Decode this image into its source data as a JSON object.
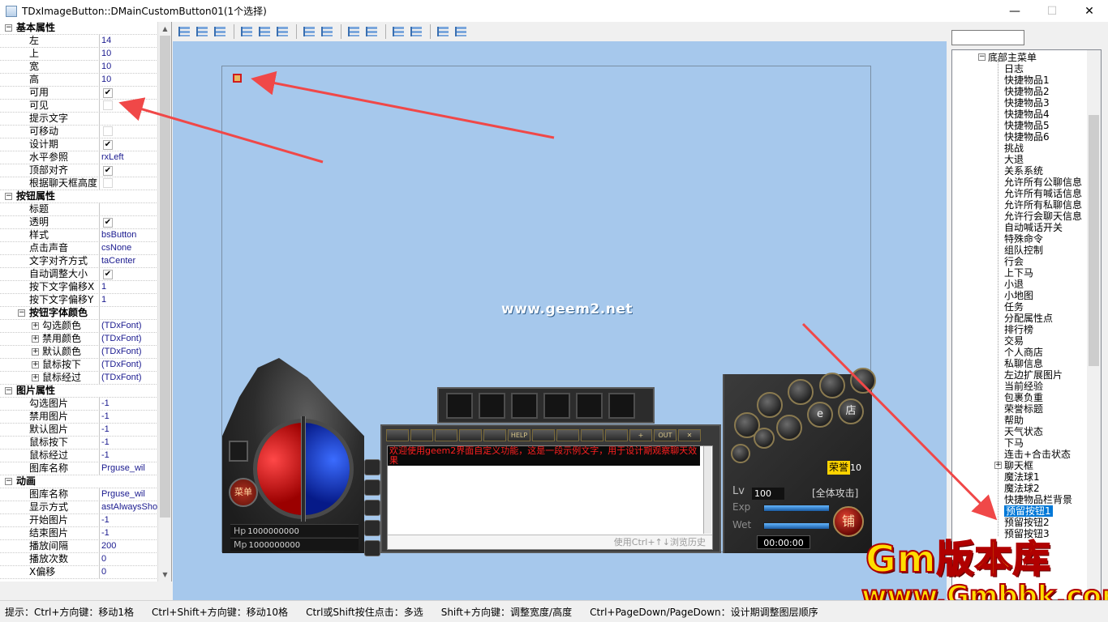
{
  "window": {
    "title": "TDxImageButton::DMainCustomButton01(1个选择)",
    "minimize": "—",
    "maximize": "☐",
    "close": "✕"
  },
  "props": {
    "cat_basic": "基本属性",
    "rows_basic": [
      {
        "k": "左",
        "v": "14"
      },
      {
        "k": "上",
        "v": "10"
      },
      {
        "k": "宽",
        "v": "10"
      },
      {
        "k": "高",
        "v": "10"
      },
      {
        "k": "可用",
        "v": "✔"
      },
      {
        "k": "可见",
        "v": ""
      },
      {
        "k": "提示文字",
        "v": ""
      },
      {
        "k": "可移动",
        "v": ""
      },
      {
        "k": "设计期",
        "v": "✔"
      },
      {
        "k": "水平参照",
        "v": "rxLeft"
      },
      {
        "k": "顶部对齐",
        "v": "✔"
      },
      {
        "k": "根据聊天框高度",
        "v": ""
      }
    ],
    "cat_button": "按钮属性",
    "rows_button": [
      {
        "k": "标题",
        "v": ""
      },
      {
        "k": "透明",
        "v": "✔"
      },
      {
        "k": "样式",
        "v": "bsButton"
      },
      {
        "k": "点击声音",
        "v": "csNone"
      },
      {
        "k": "文字对齐方式",
        "v": "taCenter"
      },
      {
        "k": "自动调整大小",
        "v": "✔"
      },
      {
        "k": "按下文字偏移X",
        "v": "1"
      },
      {
        "k": "按下文字偏移Y",
        "v": "1"
      }
    ],
    "subcat_fontcolor": "按钮字体颜色",
    "rows_font": [
      {
        "k": "勾选颜色",
        "v": "(TDxFont)"
      },
      {
        "k": "禁用颜色",
        "v": "(TDxFont)"
      },
      {
        "k": "默认颜色",
        "v": "(TDxFont)"
      },
      {
        "k": "鼠标按下",
        "v": "(TDxFont)"
      },
      {
        "k": "鼠标经过",
        "v": "(TDxFont)"
      }
    ],
    "cat_image": "图片属性",
    "rows_image": [
      {
        "k": "勾选图片",
        "v": "-1"
      },
      {
        "k": "禁用图片",
        "v": "-1"
      },
      {
        "k": "默认图片",
        "v": "-1"
      },
      {
        "k": "鼠标按下",
        "v": "-1"
      },
      {
        "k": "鼠标经过",
        "v": "-1"
      },
      {
        "k": "图库名称",
        "v": "Prguse_wil"
      }
    ],
    "cat_anim": "动画",
    "rows_anim": [
      {
        "k": "图库名称",
        "v": "Prguse_wil"
      },
      {
        "k": "显示方式",
        "v": "astAlwaysShow"
      },
      {
        "k": "开始图片",
        "v": "-1"
      },
      {
        "k": "结束图片",
        "v": "-1"
      },
      {
        "k": "播放间隔",
        "v": "200"
      },
      {
        "k": "播放次数",
        "v": "0"
      },
      {
        "k": "X偏移",
        "v": "0"
      }
    ]
  },
  "canvas": {
    "watermark": "www.geem2.net",
    "hp_label": "Hp",
    "hp_value": "1000000000",
    "mp_label": "Mp",
    "mp_value": "1000000000",
    "menu_label": "菜单",
    "chat_message": "欢迎使用geem2界面自定义功能，这是一段示例文字，用于设计期观察聊天效果",
    "chat_history": "使用Ctrl+↑↓浏览历史",
    "chat_tools": [
      "",
      "",
      "",
      "",
      "",
      "HELP",
      "",
      "",
      "",
      "",
      "+",
      "OUT",
      "✕"
    ],
    "honor_label": "荣誉",
    "honor_value": "10",
    "lv_label": "Lv",
    "lv_value": "100",
    "attack_mode": "[全体攻击]",
    "exp_label": "Exp",
    "wet_label": "Wet",
    "timer": "00:00:00",
    "shop_label": "铺",
    "round_buttons": [
      "",
      "",
      "",
      "",
      "",
      "",
      "e",
      "店",
      "",
      ""
    ]
  },
  "tree": {
    "root": "底部主菜单",
    "items": [
      "日志",
      "快捷物品1",
      "快捷物品2",
      "快捷物品3",
      "快捷物品4",
      "快捷物品5",
      "快捷物品6",
      "挑战",
      "大退",
      "关系系统",
      "允许所有公聊信息",
      "允许所有喊话信息",
      "允许所有私聊信息",
      "允许行会聊天信息",
      "自动喊话开关",
      "特殊命令",
      "组队控制",
      "行会",
      "上下马",
      "小退",
      "小地图",
      "任务",
      "分配属性点",
      "排行榜",
      "交易",
      "个人商店",
      "私聊信息",
      "左边扩展图片",
      "当前经验",
      "包裹负重",
      "荣誉标题",
      "帮助",
      "天气状态",
      "下马",
      "连击+合击状态",
      "聊天框",
      "魔法球1",
      "魔法球2",
      "快捷物品栏背景",
      "预留按钮1",
      "预留按钮2",
      "预留按钮3"
    ],
    "selected_index": 39
  },
  "logo": {
    "main": "Gm版本库",
    "url": "www.Gmbbk.com"
  },
  "status": [
    "提示：Ctrl+方向键：移动1格",
    "Ctrl+Shift+方向键：移动10格",
    "Ctrl或Shift按住点击：多选",
    "Shift+方向键：调整宽度/高度",
    "Ctrl+PageDown/PageDown：设计期调整图层顺序"
  ],
  "colors": {
    "canvas_bg": "#a6c8ec",
    "selection": "#d01c1c",
    "tree_selected": "#0078d7",
    "annotation_arrow": "#f04848"
  }
}
